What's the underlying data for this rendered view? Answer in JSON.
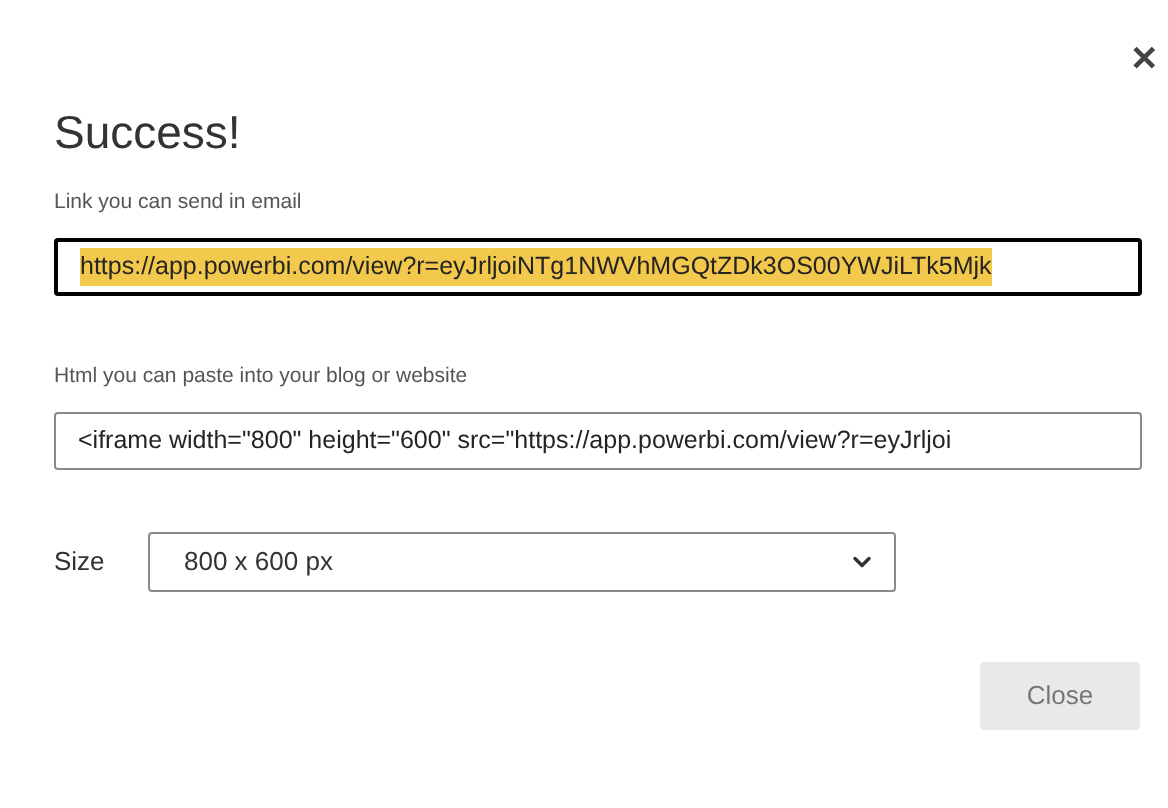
{
  "dialog": {
    "title": "Success!",
    "close_glyph": "✕"
  },
  "link": {
    "label": "Link you can send in email",
    "value": "https://app.powerbi.com/view?r=eyJrljoiNTg1NWVhMGQtZDk3OS00YWJiLTk5Mjk",
    "selected": true
  },
  "html": {
    "label": "Html you can paste into your blog or website",
    "value": "<iframe width=\"800\" height=\"600\" src=\"https://app.powerbi.com/view?r=eyJrljoi",
    "selected": false
  },
  "size": {
    "label": "Size",
    "value": "800 x 600 px"
  },
  "buttons": [
    {
      "label": "Close",
      "disabled": true
    }
  ]
}
